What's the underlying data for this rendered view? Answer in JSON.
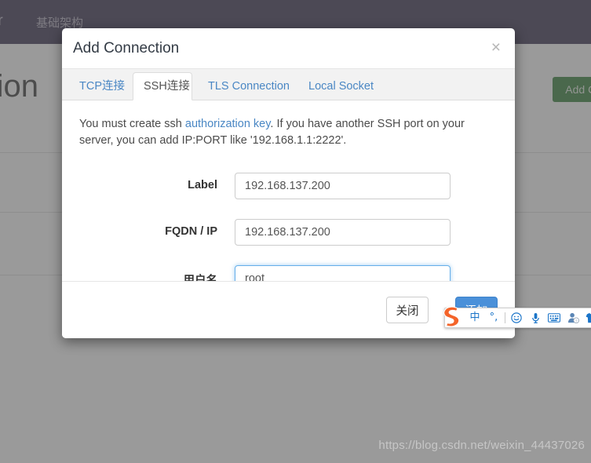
{
  "background": {
    "navbar": {
      "brand": "lgr",
      "link": "基础架构",
      "bg_color": "#342c4b"
    },
    "page_title": "nection",
    "add_connection_button": "Add Co",
    "add_button_color": "#2f7b32"
  },
  "modal": {
    "title": "Add Connection",
    "close_icon": "×",
    "tabs": [
      {
        "label": "TCP连接",
        "active": false
      },
      {
        "label": "SSH连接",
        "active": true
      },
      {
        "label": "TLS Connection",
        "active": false
      },
      {
        "label": "Local Socket",
        "active": false
      }
    ],
    "help": {
      "part1": "You must create ssh ",
      "link": "authorization key",
      "part2": ". If you have another SSH port on your server, you can add IP:PORT like '192.168.1.1:2222'.",
      "link_color": "#4a87c4"
    },
    "fields": [
      {
        "label": "Label",
        "value": "192.168.137.200",
        "focused": false
      },
      {
        "label": "FQDN / IP",
        "value": "192.168.137.200",
        "focused": false
      },
      {
        "label": "用户名",
        "value": "root",
        "focused": true
      }
    ],
    "footer": {
      "close_label": "关闭",
      "submit_label": "添加",
      "submit_color": "#4a90d9"
    }
  },
  "ime": {
    "logo": "S",
    "items": [
      {
        "name": "chinese-mode-icon",
        "glyph": "中"
      },
      {
        "name": "punctuation-icon",
        "glyph": "°,"
      },
      {
        "name": "emoji-icon",
        "glyph": "☺"
      },
      {
        "name": "microphone-icon",
        "glyph": "🎤"
      },
      {
        "name": "soft-keyboard-icon",
        "glyph": "⌨"
      },
      {
        "name": "user-account-icon",
        "glyph": "👤"
      },
      {
        "name": "skin-theme-icon",
        "glyph": "👕"
      }
    ]
  },
  "watermark": "https://blog.csdn.net/weixin_44437026"
}
